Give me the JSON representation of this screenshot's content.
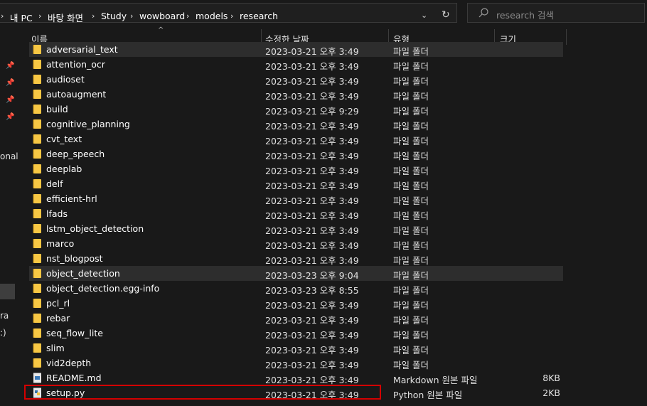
{
  "address": {
    "crumbs": [
      "내 PC",
      "바탕 화면",
      "Study",
      "wowboard",
      "models",
      "research"
    ]
  },
  "search": {
    "placeholder": "research 검색"
  },
  "nav": {
    "partial_items": [
      "onal",
      "ra",
      ":)"
    ]
  },
  "columns": {
    "name": "이름",
    "date": "수정한 날짜",
    "type": "유형",
    "size": "크기"
  },
  "files": [
    {
      "name": "adversarial_text",
      "date": "2023-03-21 오후 3:49",
      "type": "파일 폴더",
      "size": "",
      "icon": "folder-icon"
    },
    {
      "name": "attention_ocr",
      "date": "2023-03-21 오후 3:49",
      "type": "파일 폴더",
      "size": "",
      "icon": "folder-icon"
    },
    {
      "name": "audioset",
      "date": "2023-03-21 오후 3:49",
      "type": "파일 폴더",
      "size": "",
      "icon": "folder-icon"
    },
    {
      "name": "autoaugment",
      "date": "2023-03-21 오후 3:49",
      "type": "파일 폴더",
      "size": "",
      "icon": "folder-icon"
    },
    {
      "name": "build",
      "date": "2023-03-21 오후 9:29",
      "type": "파일 폴더",
      "size": "",
      "icon": "folder-icon"
    },
    {
      "name": "cognitive_planning",
      "date": "2023-03-21 오후 3:49",
      "type": "파일 폴더",
      "size": "",
      "icon": "folder-icon"
    },
    {
      "name": "cvt_text",
      "date": "2023-03-21 오후 3:49",
      "type": "파일 폴더",
      "size": "",
      "icon": "folder-icon"
    },
    {
      "name": "deep_speech",
      "date": "2023-03-21 오후 3:49",
      "type": "파일 폴더",
      "size": "",
      "icon": "folder-icon"
    },
    {
      "name": "deeplab",
      "date": "2023-03-21 오후 3:49",
      "type": "파일 폴더",
      "size": "",
      "icon": "folder-icon"
    },
    {
      "name": "delf",
      "date": "2023-03-21 오후 3:49",
      "type": "파일 폴더",
      "size": "",
      "icon": "folder-icon"
    },
    {
      "name": "efficient-hrl",
      "date": "2023-03-21 오후 3:49",
      "type": "파일 폴더",
      "size": "",
      "icon": "folder-icon"
    },
    {
      "name": "lfads",
      "date": "2023-03-21 오후 3:49",
      "type": "파일 폴더",
      "size": "",
      "icon": "folder-icon"
    },
    {
      "name": "lstm_object_detection",
      "date": "2023-03-21 오후 3:49",
      "type": "파일 폴더",
      "size": "",
      "icon": "folder-icon"
    },
    {
      "name": "marco",
      "date": "2023-03-21 오후 3:49",
      "type": "파일 폴더",
      "size": "",
      "icon": "folder-icon"
    },
    {
      "name": "nst_blogpost",
      "date": "2023-03-21 오후 3:49",
      "type": "파일 폴더",
      "size": "",
      "icon": "folder-icon"
    },
    {
      "name": "object_detection",
      "date": "2023-03-23 오후 9:04",
      "type": "파일 폴더",
      "size": "",
      "icon": "folder-icon"
    },
    {
      "name": "object_detection.egg-info",
      "date": "2023-03-23 오후 8:55",
      "type": "파일 폴더",
      "size": "",
      "icon": "folder-icon"
    },
    {
      "name": "pcl_rl",
      "date": "2023-03-21 오후 3:49",
      "type": "파일 폴더",
      "size": "",
      "icon": "folder-icon"
    },
    {
      "name": "rebar",
      "date": "2023-03-21 오후 3:49",
      "type": "파일 폴더",
      "size": "",
      "icon": "folder-icon"
    },
    {
      "name": "seq_flow_lite",
      "date": "2023-03-21 오후 3:49",
      "type": "파일 폴더",
      "size": "",
      "icon": "folder-icon"
    },
    {
      "name": "slim",
      "date": "2023-03-21 오후 3:49",
      "type": "파일 폴더",
      "size": "",
      "icon": "folder-icon"
    },
    {
      "name": "vid2depth",
      "date": "2023-03-21 오후 3:49",
      "type": "파일 폴더",
      "size": "",
      "icon": "folder-icon"
    },
    {
      "name": "README.md",
      "date": "2023-03-21 오후 3:49",
      "type": "Markdown 원본 파일",
      "size": "8KB",
      "icon": "markdown-file-icon"
    },
    {
      "name": "setup.py",
      "date": "2023-03-21 오후 3:49",
      "type": "Python 원본 파일",
      "size": "2KB",
      "icon": "python-file-icon"
    }
  ],
  "highlighted_rows": [
    "adversarial_text",
    "object_detection"
  ],
  "selected_file": "setup.py",
  "colors": {
    "background": "#191919",
    "hover": "#2d2d2d",
    "folder": "#f7c744",
    "selection_outline": "#d40000"
  }
}
